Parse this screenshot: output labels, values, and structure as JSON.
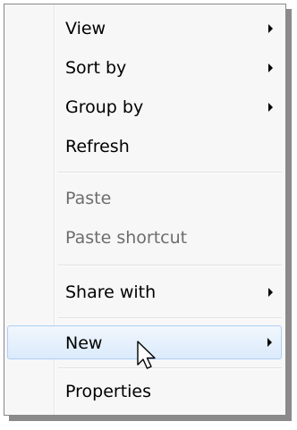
{
  "context_menu": {
    "items": [
      {
        "label": "View"
      },
      {
        "label": "Sort by"
      },
      {
        "label": "Group by"
      },
      {
        "label": "Refresh"
      },
      {
        "label": "Paste"
      },
      {
        "label": "Paste shortcut"
      },
      {
        "label": "Share with"
      },
      {
        "label": "New"
      },
      {
        "label": "Properties"
      }
    ],
    "highlighted_item": "New",
    "disabled_items": [
      "Paste",
      "Paste shortcut"
    ],
    "submenu_arrow_icon": "chevron-right-icon",
    "cursor_icon": "mouse-pointer-icon",
    "colors": {
      "background": "#f7f7f7",
      "highlight_border": "#aecff7",
      "disabled_text": "#6d6d6d"
    }
  }
}
